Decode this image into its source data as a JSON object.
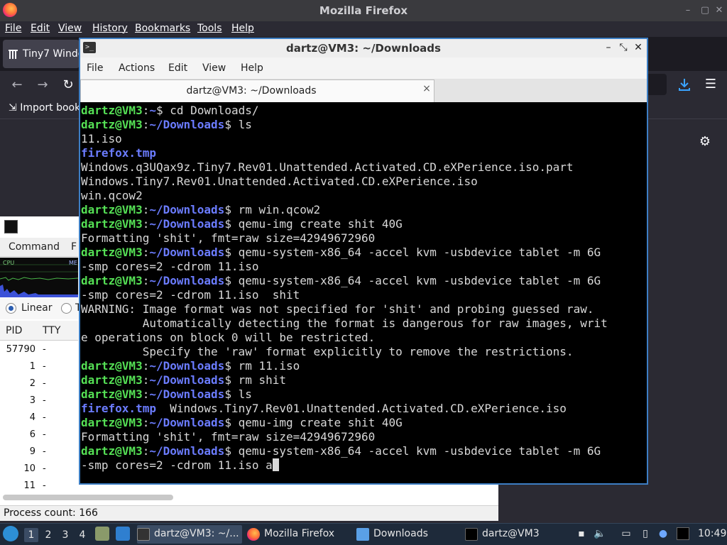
{
  "firefox": {
    "title": "Mozilla Firefox",
    "menu": [
      "File",
      "Edit",
      "View",
      "History",
      "Bookmarks",
      "Tools",
      "Help"
    ],
    "tab_label": "Tiny7 Windo",
    "import_bookmarks": "Import book",
    "icons": {
      "back": "back-arrow-icon",
      "forward": "forward-arrow-icon",
      "reload": "reload-icon",
      "download": "download-icon",
      "menu": "hamburger-menu-icon",
      "settings": "gear-icon"
    },
    "colors": {
      "accent": "#3aa3ff",
      "bg": "#2b2a33"
    }
  },
  "task_manager": {
    "tabs": [
      "Command",
      "F"
    ],
    "graph_labels": {
      "cpu": "CPU",
      "mem": "ME"
    },
    "radio_linear": "Linear",
    "radio_other": "T",
    "columns": [
      "PID",
      "TTY"
    ],
    "rows": [
      {
        "pid": "57790",
        "tty": "-"
      },
      {
        "pid": "1",
        "tty": "-"
      },
      {
        "pid": "2",
        "tty": "-"
      },
      {
        "pid": "3",
        "tty": "-"
      },
      {
        "pid": "4",
        "tty": "-"
      },
      {
        "pid": "6",
        "tty": "-"
      },
      {
        "pid": "9",
        "tty": "-"
      },
      {
        "pid": "10",
        "tty": "-"
      },
      {
        "pid": "11",
        "tty": "-"
      }
    ],
    "status": "Process count: 166"
  },
  "terminal": {
    "title": "dartz@VM3: ~/Downloads",
    "menu": [
      "File",
      "Actions",
      "Edit",
      "View",
      "Help"
    ],
    "tab_label": "dartz@VM3: ~/Downloads",
    "close_glyph": "×",
    "lines": [
      [
        {
          "t": "dartz@VM3",
          "c": "u"
        },
        {
          "t": ":",
          "c": ""
        },
        {
          "t": "~",
          "c": "d"
        },
        {
          "t": "$ cd Downloads/",
          "c": ""
        }
      ],
      [
        {
          "t": "dartz@VM3",
          "c": "u"
        },
        {
          "t": ":",
          "c": ""
        },
        {
          "t": "~/Downloads",
          "c": "d"
        },
        {
          "t": "$ ls",
          "c": ""
        }
      ],
      [
        {
          "t": "11.iso",
          "c": ""
        }
      ],
      [
        {
          "t": "firefox.tmp",
          "c": "p"
        }
      ],
      [
        {
          "t": "Windows.q3UQax9z.Tiny7.Rev01.Unattended.Activated.CD.eXPerience.iso.part",
          "c": ""
        }
      ],
      [
        {
          "t": "Windows.Tiny7.Rev01.Unattended.Activated.CD.eXPerience.iso",
          "c": ""
        }
      ],
      [
        {
          "t": "win.qcow2",
          "c": ""
        }
      ],
      [
        {
          "t": "dartz@VM3",
          "c": "u"
        },
        {
          "t": ":",
          "c": ""
        },
        {
          "t": "~/Downloads",
          "c": "d"
        },
        {
          "t": "$ rm win.qcow2",
          "c": ""
        }
      ],
      [
        {
          "t": "dartz@VM3",
          "c": "u"
        },
        {
          "t": ":",
          "c": ""
        },
        {
          "t": "~/Downloads",
          "c": "d"
        },
        {
          "t": "$ qemu-img create shit 40G",
          "c": ""
        }
      ],
      [
        {
          "t": "Formatting 'shit', fmt=raw size=42949672960",
          "c": ""
        }
      ],
      [
        {
          "t": "dartz@VM3",
          "c": "u"
        },
        {
          "t": ":",
          "c": ""
        },
        {
          "t": "~/Downloads",
          "c": "d"
        },
        {
          "t": "$ qemu-system-x86_64 -accel kvm -usbdevice tablet -m 6G",
          "c": ""
        }
      ],
      [
        {
          "t": "-smp cores=2 -cdrom 11.iso",
          "c": ""
        }
      ],
      [
        {
          "t": "dartz@VM3",
          "c": "u"
        },
        {
          "t": ":",
          "c": ""
        },
        {
          "t": "~/Downloads",
          "c": "d"
        },
        {
          "t": "$ qemu-system-x86_64 -accel kvm -usbdevice tablet -m 6G",
          "c": ""
        }
      ],
      [
        {
          "t": "-smp cores=2 -cdrom 11.iso  shit",
          "c": ""
        }
      ],
      [
        {
          "t": "WARNING: Image format was not specified for 'shit' and probing guessed raw.",
          "c": ""
        }
      ],
      [
        {
          "t": "         Automatically detecting the format is dangerous for raw images, writ",
          "c": ""
        }
      ],
      [
        {
          "t": "e operations on block 0 will be restricted.",
          "c": ""
        }
      ],
      [
        {
          "t": "         Specify the 'raw' format explicitly to remove the restrictions.",
          "c": ""
        }
      ],
      [
        {
          "t": "dartz@VM3",
          "c": "u"
        },
        {
          "t": ":",
          "c": ""
        },
        {
          "t": "~/Downloads",
          "c": "d"
        },
        {
          "t": "$ rm 11.iso",
          "c": ""
        }
      ],
      [
        {
          "t": "dartz@VM3",
          "c": "u"
        },
        {
          "t": ":",
          "c": ""
        },
        {
          "t": "~/Downloads",
          "c": "d"
        },
        {
          "t": "$ rm shit",
          "c": ""
        }
      ],
      [
        {
          "t": "dartz@VM3",
          "c": "u"
        },
        {
          "t": ":",
          "c": ""
        },
        {
          "t": "~/Downloads",
          "c": "d"
        },
        {
          "t": "$ ls",
          "c": ""
        }
      ],
      [
        {
          "t": "firefox.tmp",
          "c": "p"
        },
        {
          "t": "  Windows.Tiny7.Rev01.Unattended.Activated.CD.eXPerience.iso",
          "c": ""
        }
      ],
      [
        {
          "t": "dartz@VM3",
          "c": "u"
        },
        {
          "t": ":",
          "c": ""
        },
        {
          "t": "~/Downloads",
          "c": "d"
        },
        {
          "t": "$ qemu-img create shit 40G",
          "c": ""
        }
      ],
      [
        {
          "t": "Formatting 'shit', fmt=raw size=42949672960",
          "c": ""
        }
      ],
      [
        {
          "t": "dartz@VM3",
          "c": "u"
        },
        {
          "t": ":",
          "c": ""
        },
        {
          "t": "~/Downloads",
          "c": "d"
        },
        {
          "t": "$ qemu-system-x86_64 -accel kvm -usbdevice tablet -m 6G",
          "c": ""
        }
      ],
      [
        {
          "t": "-smp cores=2 -cdrom 11.iso a",
          "c": ""
        }
      ]
    ],
    "colors": {
      "user": "#55e055",
      "path": "#6b7cff",
      "text": "#d8d8d8",
      "border": "#3d7ec4"
    }
  },
  "taskbar": {
    "workspaces": [
      "1",
      "2",
      "3",
      "4"
    ],
    "tasks": [
      {
        "label": "dartz@VM3: ~/...",
        "icon": "terminal-icon"
      },
      {
        "label": "Mozilla Firefox",
        "icon": "firefox-icon"
      },
      {
        "label": "Downloads",
        "icon": "folder-icon"
      },
      {
        "label": "dartz@VM3",
        "icon": "black-window-icon"
      }
    ],
    "clock": "10:49"
  }
}
